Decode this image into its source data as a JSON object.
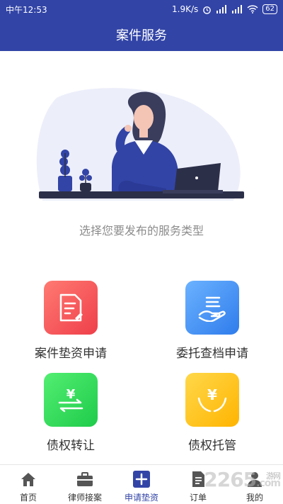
{
  "status": {
    "time": "中午12:53",
    "speed": "1.9K/s",
    "battery": "62"
  },
  "header": {
    "title": "案件服务"
  },
  "prompt": "选择您要发布的服务类型",
  "services": [
    {
      "label": "案件垫资申请",
      "icon": "document-pen-icon",
      "color": "#f2565b"
    },
    {
      "label": "委托查档申请",
      "icon": "hand-documents-icon",
      "color": "#3a8ef5"
    },
    {
      "label": "债权转让",
      "icon": "yuan-transfer-icon",
      "color": "#2fd85a"
    },
    {
      "label": "债权托管",
      "icon": "yuan-hands-icon",
      "color": "#ffc21a"
    }
  ],
  "tabs": [
    {
      "label": "首页",
      "icon": "home-icon"
    },
    {
      "label": "律师接案",
      "icon": "briefcase-icon"
    },
    {
      "label": "申请垫资",
      "icon": "plus-square-icon",
      "active": true
    },
    {
      "label": "订单",
      "icon": "order-doc-icon"
    },
    {
      "label": "我的",
      "icon": "person-icon"
    }
  ],
  "watermark": {
    "text": "2265",
    "suffix": "游网",
    "domain": ".com"
  },
  "colors": {
    "primary": "#3244a6"
  }
}
